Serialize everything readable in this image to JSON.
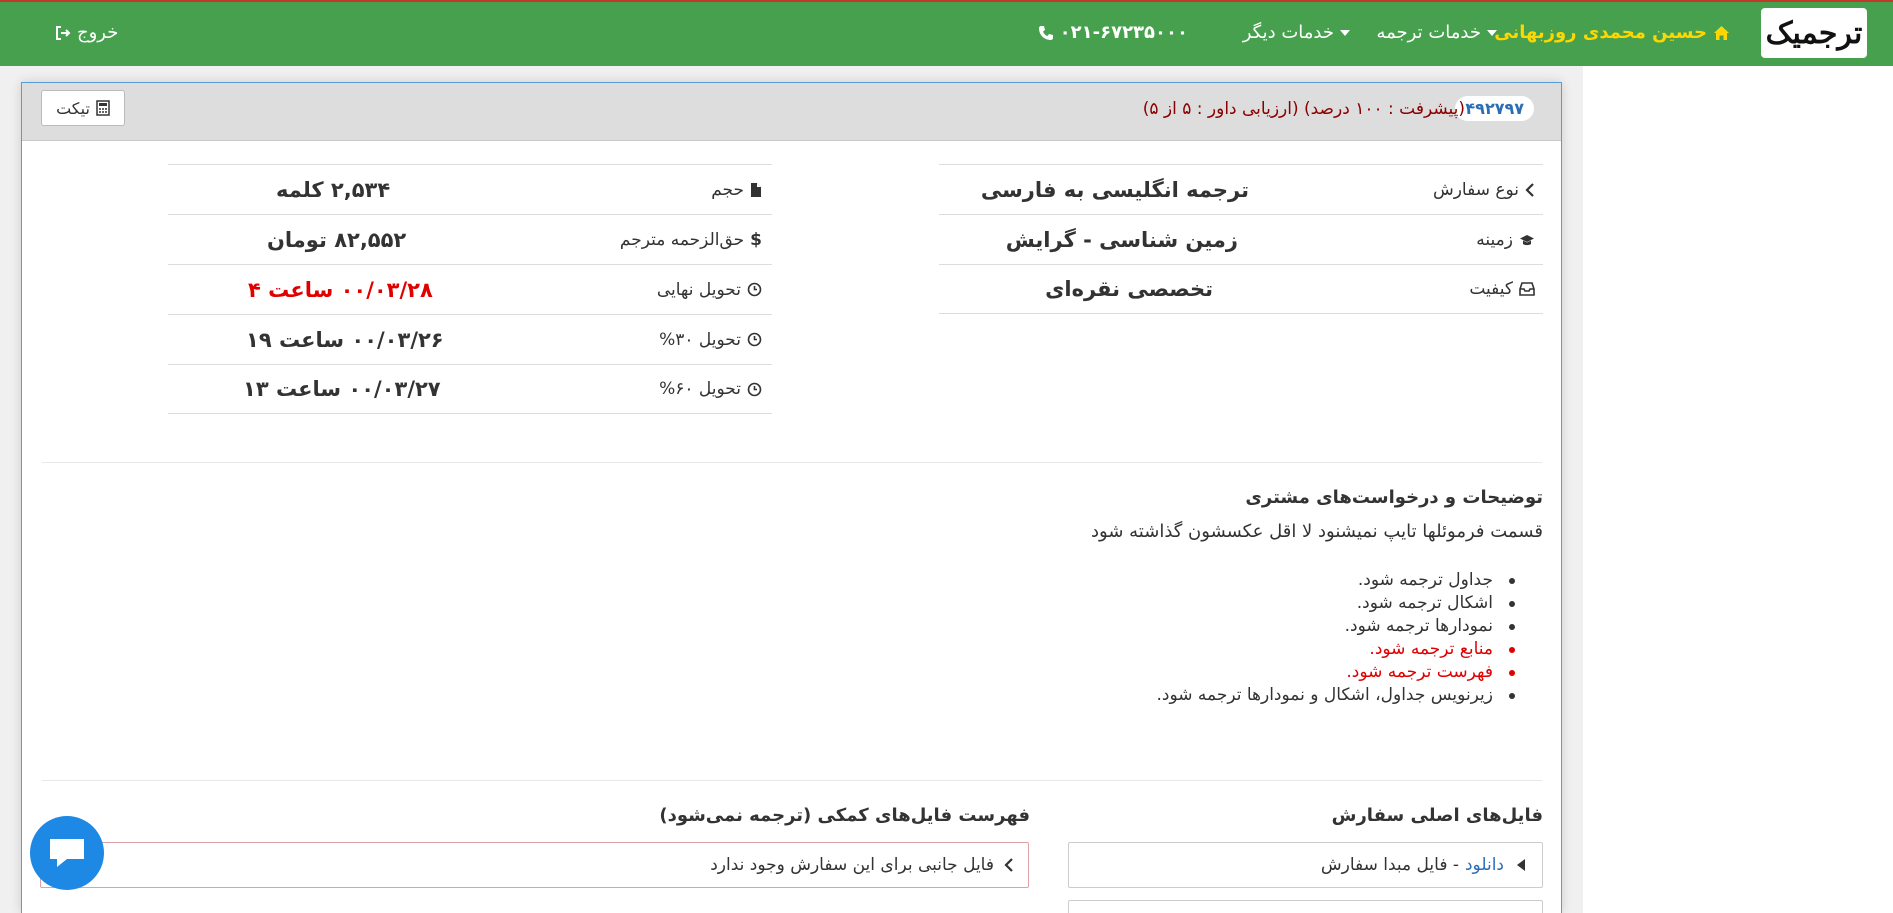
{
  "navbar": {
    "logo_text": "ترجمیک",
    "user_name": "حسین محمدی روزبهانی",
    "translation_services": "خدمات ترجمه",
    "other_services": "خدمات دیگر",
    "phone": "۰۲۱-۶۷۲۳۵۰۰۰",
    "logout": "خروج"
  },
  "order": {
    "id": "۴۹۲۷۹۷",
    "progress_text": "(پیشرفت : ۱۰۰ درصد) (ارزیابی داور : ۵ از ۵)",
    "ticket_label": "تیکت"
  },
  "details_right": [
    {
      "label": "نوع سفارش",
      "icon": "chevron-left-icon",
      "value": "ترجمه انگلیسی به فارسی"
    },
    {
      "label": "زمینه",
      "icon": "graduation-cap-icon",
      "value": "زمین شناسی - گرایش"
    },
    {
      "label": "کیفیت",
      "icon": "inbox-icon",
      "value": "تخصصی نقره‌ای"
    }
  ],
  "details_left": [
    {
      "label": "حجم",
      "icon": "file-icon",
      "value": "۲,۵۳۴ کلمه"
    },
    {
      "label": "حق‌الزحمه مترجم",
      "icon": "dollar-icon",
      "value": "۸۲,۵۵۲ تومان"
    },
    {
      "label": "تحویل نهایی",
      "icon": "clock-icon",
      "value": "۰۰/۰۳/۲۸ ساعت ۴"
    },
    {
      "label": "تحویل ۳۰%",
      "icon": "clock-icon",
      "value": "۰۰/۰۳/۲۶ ساعت ۱۹"
    },
    {
      "label": "تحویل ۶۰%",
      "icon": "clock-icon",
      "value": "۰۰/۰۳/۲۷ ساعت ۱۳"
    }
  ],
  "customer": {
    "title": "توضیحات و درخواست‌های مشتری",
    "description": "قسمت فرموئلها تایپ نمیشنود لا اقل عکسشون گذاشته شود",
    "requirements": [
      {
        "text": "جداول ترجمه شود.",
        "color": "#333333"
      },
      {
        "text": "اشکال ترجمه شود.",
        "color": "#333333"
      },
      {
        "text": "نمودارها ترجمه شود.",
        "color": "#333333"
      },
      {
        "text": "منابع ترجمه شود.",
        "color": "#e00000"
      },
      {
        "text": "فهرست ترجمه شود.",
        "color": "#e00000"
      },
      {
        "text": "زیرنویس جداول، اشکال و نمودارها ترجمه شود.",
        "color": "#333333"
      }
    ]
  },
  "files": {
    "main_title": "فایل‌های اصلی سفارش",
    "download_label": "دانلود",
    "source_file_label": "- فایل مبدا سفارش",
    "aux_title": "فهرست فایل‌های کمکی (ترجمه نمی‌شود)",
    "no_aux_text": "فایل جانبی برای این سفارش وجود ندارد"
  },
  "colors": {
    "navbar": "#46a04e",
    "user_name": "#ffd700",
    "progress": "#8b0000",
    "deadline": "#e00000",
    "link": "#2c6eb5",
    "chat": "#1e88e5"
  }
}
